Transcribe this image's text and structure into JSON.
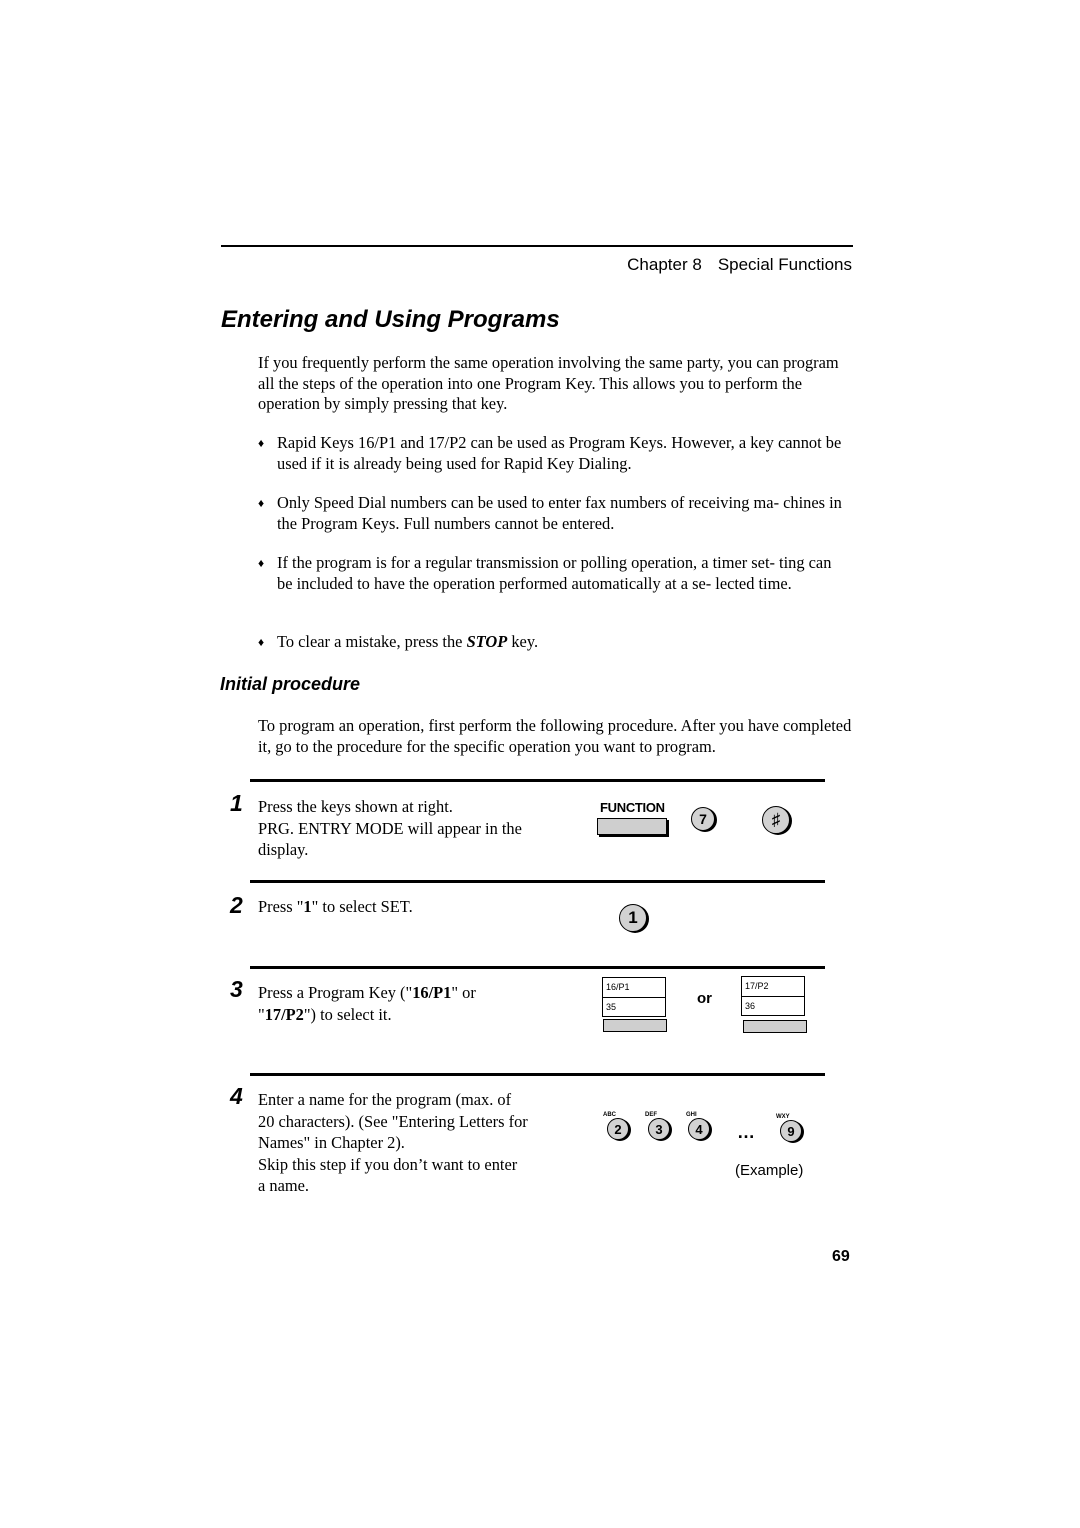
{
  "header": {
    "chapter": "Chapter 8",
    "section": "Special Functions"
  },
  "title": "Entering and Using Programs",
  "intro": "If you frequently perform the same operation involving the same party, you can program all the steps of the operation into one Program Key. This allows you to perform the operation by simply pressing that key.",
  "bullet_symbol": "♦",
  "bullets": [
    {
      "text": "Rapid Keys 16/P1 and 17/P2 can be used as Program Keys. However, a key cannot be used if it is already being used for Rapid Key Dialing."
    },
    {
      "text": "Only Speed Dial numbers can be used to enter fax numbers of receiving ma- chines in the Program Keys. Full numbers cannot be entered."
    },
    {
      "text": "If the program is for a regular transmission or polling operation, a timer set- ting can be included to have the operation performed automatically at a se- lected time."
    },
    {
      "pre": "To clear a mistake, press the ",
      "em": "STOP",
      "post": " key."
    }
  ],
  "subsection": {
    "title": "Initial procedure",
    "intro": "To program an operation, first perform the following procedure. After you have completed it, go to the procedure for the specific operation you want to program."
  },
  "steps": [
    {
      "number": "1",
      "lines": [
        "Press the keys shown at right.",
        "PRG. ENTRY MODE will appear in the",
        "display."
      ],
      "keys": {
        "function_label": "FUNCTION",
        "key_7": "7",
        "key_hash": "♯"
      }
    },
    {
      "number": "2",
      "pre": "Press \"",
      "bold": "1",
      "post": "\" to select SET.",
      "keys": {
        "key_1": "1"
      }
    },
    {
      "number": "3",
      "line1_pre": "Press a Program Key (\"",
      "line1_bold": "16/P1",
      "line1_post": "\" or",
      "line2_pre": "\"",
      "line2_bold": "17/P2",
      "line2_post": "\") to select it.",
      "keys": {
        "p1_top": "16/P1",
        "p1_bottom": "35",
        "or": "or",
        "p2_top": "17/P2",
        "p2_bottom": "36"
      }
    },
    {
      "number": "4",
      "lines": [
        "Enter a name for the program (max. of",
        "20 characters). (See \"Entering Letters for",
        "Names\" in Chapter 2).",
        "Skip this step if you don’t want to enter",
        "a name."
      ],
      "keys": [
        {
          "digit": "2",
          "letters": "ABC"
        },
        {
          "digit": "3",
          "letters": "DEF"
        },
        {
          "digit": "4",
          "letters": "GHI"
        },
        {
          "digit": "9",
          "letters": "WXY"
        }
      ],
      "ellipsis": "…",
      "caption": "(Example)"
    }
  ],
  "page_number": "69"
}
